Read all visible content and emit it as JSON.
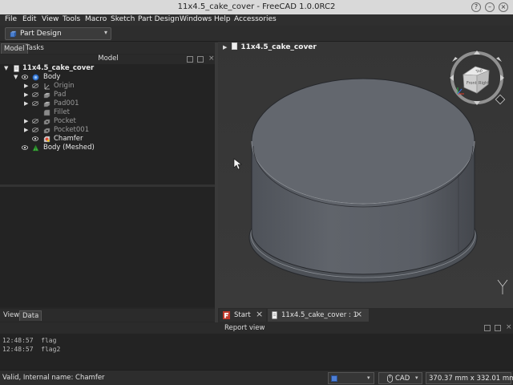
{
  "window": {
    "title": "11x4.5_cake_cover - FreeCAD 1.0.0RC2",
    "controls": {
      "help": "?",
      "minimize": "–",
      "close": "×"
    }
  },
  "menu": [
    "File",
    "Edit",
    "View",
    "Tools",
    "Macro",
    "Sketch",
    "Part Design",
    "Windows",
    "Help",
    "Accessories"
  ],
  "workbench": {
    "selected": "Part Design"
  },
  "left_panel": {
    "tabs": [
      "Model",
      "Tasks"
    ],
    "header": "Model",
    "tree": [
      {
        "label": "11x4.5_cake_cover",
        "icon": "document-icon",
        "style": "bold"
      },
      {
        "label": "Body",
        "icon": "body-icon",
        "style": "normal"
      },
      {
        "label": "Origin",
        "icon": "origin-icon",
        "style": "dim"
      },
      {
        "label": "Pad",
        "icon": "pad-icon",
        "style": "dim"
      },
      {
        "label": "Pad001",
        "icon": "pad-icon",
        "style": "dim"
      },
      {
        "label": "Fillet",
        "icon": "fillet-icon",
        "style": "dim"
      },
      {
        "label": "Pocket",
        "icon": "pocket-icon",
        "style": "dim"
      },
      {
        "label": "Pocket001",
        "icon": "pocket-icon",
        "style": "dim"
      },
      {
        "label": "Chamfer",
        "icon": "chamfer-icon",
        "style": "normal"
      },
      {
        "label": "Body (Meshed)",
        "icon": "mesh-icon",
        "style": "normal"
      }
    ],
    "bottom_tabs": [
      "View",
      "Data"
    ]
  },
  "view3d": {
    "document_label": "11x4.5_cake_cover",
    "navcube": {
      "top": "Top",
      "front": "Front",
      "right": "Right"
    },
    "colors": {
      "body": "#5b5f66",
      "top": "#636870",
      "edge": "#2a2c30",
      "rim": "#8a8e94"
    }
  },
  "doc_tabs": [
    {
      "label": "Start",
      "icon": "freecad-logo-icon"
    },
    {
      "label": "11x4.5_cake_cover : 1",
      "icon": "document-icon"
    }
  ],
  "report": {
    "header": "Report view",
    "lines": [
      {
        "time": "12:48:57",
        "text": "flag"
      },
      {
        "time": "12:48:57",
        "text": "flag2"
      }
    ]
  },
  "status": {
    "text": "Valid, Internal name: Chamfer",
    "nav_style": "CAD",
    "dimensions": "370.37 mm x 332.01 mm"
  }
}
